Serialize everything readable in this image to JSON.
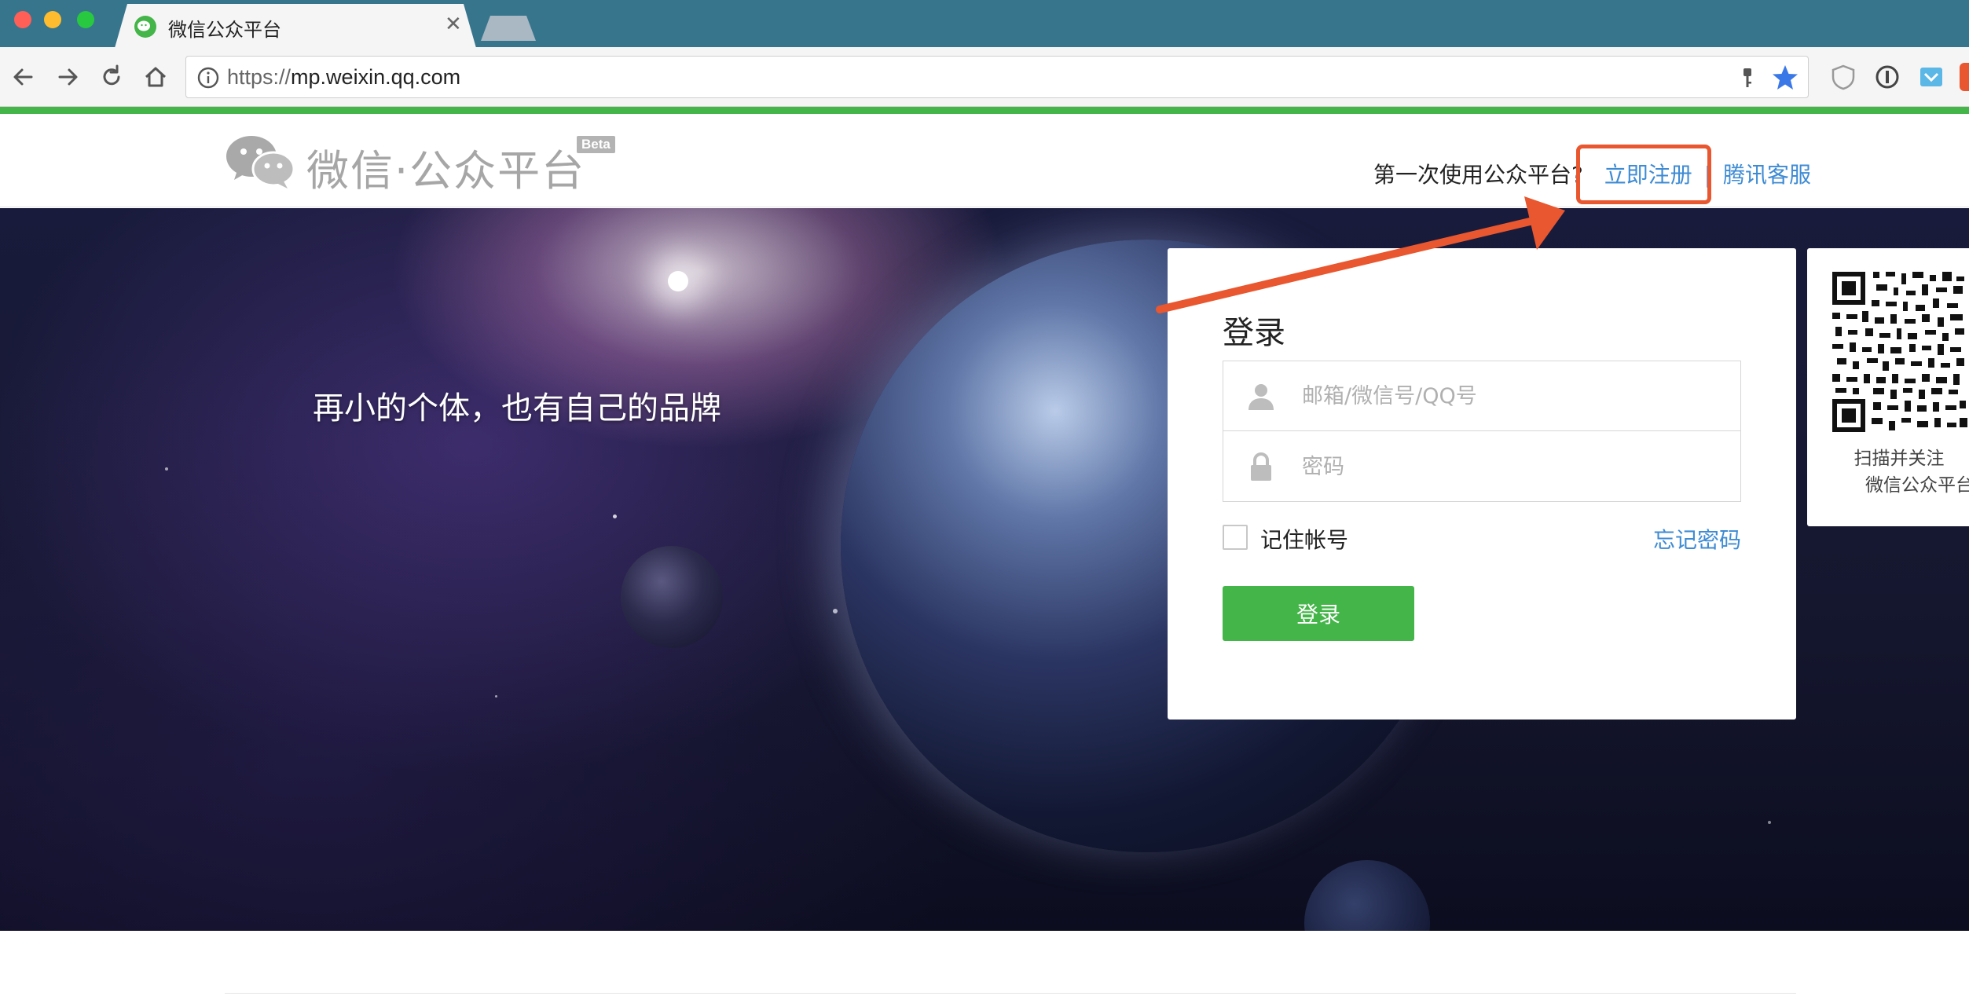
{
  "browser": {
    "tab_title": "微信公众平台",
    "url_scheme": "https://",
    "url_host": "mp.weixin.qq.com"
  },
  "header": {
    "logo_text": "微信·公众平台",
    "beta_badge": "Beta",
    "first_time_prompt": "第一次使用公众平台?",
    "register_link": "立即注册",
    "separator": "|",
    "support_link": "腾讯客服"
  },
  "banner": {
    "slogan": "再小的个体，也有自己的品牌"
  },
  "login": {
    "title": "登录",
    "username_placeholder": "邮箱/微信号/QQ号",
    "password_placeholder": "密码",
    "remember_label": "记住帐号",
    "forgot_link": "忘记密码",
    "submit_label": "登录"
  },
  "qr": {
    "line1": "扫描并关注",
    "line2": "微信公众平台"
  },
  "colors": {
    "brand_green": "#44b549",
    "link_blue": "#3e8bd4",
    "annotation_orange": "#e8572f",
    "tabstrip": "#37758d"
  },
  "icons": [
    "wechat-favicon-icon",
    "back-icon",
    "forward-icon",
    "reload-icon",
    "home-icon",
    "info-icon",
    "key-icon",
    "star-icon",
    "wechat-logo-icon",
    "user-icon",
    "lock-icon"
  ]
}
